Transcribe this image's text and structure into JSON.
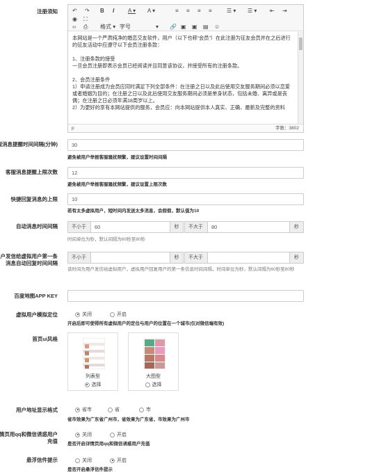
{
  "registration": {
    "label": "注册须知",
    "toolbar": {
      "format": "格式",
      "font": "字号"
    },
    "content": [
      "本网站是一个严肃纯净的婚恋交友软件，用户（以下也称“会员”）在此注册为征友会员并在之后进行的征友活动中应遵守以下会员注册条款：",
      "",
      "1、注册条款的接受",
      "一旦会员注册即表示会员已经阅读并且同意该协议，并接受所有的注册条款。",
      "",
      "2、会员注册条件",
      "1）申请注册成为会员应同时满足下列全部条件：在注册之日以及此后使用交友服务期间必须以恋爱或者婚姻为目的；在注册之日以及此后使用交友服务期间必须是单身状态，包括未婚、离异或是丧偶；在注册之日必须年满18周岁以上。",
      "2）为更好的享有本网站提供的服务，会员应：向本网站提供本人真实、正确、最新及完整的资料"
    ],
    "status_left": "p",
    "status_right": "字数：3802"
  },
  "reminder_interval": {
    "label": "客服消息提醒时间间隔(分钟)",
    "value": "30",
    "hint": "避免被用户举报客服骚扰频繁，建议设置时间间隔"
  },
  "reminder_limit": {
    "label": "客服消息提醒上限次数",
    "value": "12",
    "hint": "避免被用户举报客服骚扰频繁，建议设置上限次数"
  },
  "quick_reply_limit": {
    "label": "快捷回复消息的上限",
    "value": "10",
    "hint": "若有太多虚拟用户，短时间内发送太多消息，会假假，默认值为10"
  },
  "auto_msg_interval": {
    "label": "自动消息时间间隔",
    "min_label": "不小于",
    "min_value": "60",
    "unit": "秒",
    "max_label": "不大于",
    "max_value": "80",
    "hint": "时间单位为秒，默认间隔为60秒至80秒"
  },
  "first_msg_interval": {
    "label": "用户发信给虚拟用户第一条消息自动回复时间间隔",
    "min_label": "不小于",
    "min_value": "",
    "unit": "秒",
    "max_label": "不大于",
    "max_value": "",
    "hint": "该时间为用户发信给虚拟用户，虚拟用户回复用户的第一条信息时间间隔，时间单位为秒，默认间隔为60秒至80秒"
  },
  "baidu_key": {
    "label": "百度地图APP KEY",
    "value": ""
  },
  "virtual_location": {
    "label": "虚拟用户模拟定位",
    "options": [
      "关闭",
      "开启"
    ],
    "selected": 0,
    "hint": "开启后即可使得所有虚拟用户的定位与用户的位置在一个城市(仅对微信端有效)"
  },
  "home_style": {
    "label": "首页ui风格",
    "cards": [
      {
        "name": "列表型",
        "choose": "选择",
        "selected": true
      },
      {
        "name": "大图型",
        "choose": "选择",
        "selected": false
      }
    ]
  },
  "address_format": {
    "label": "用户地址显示格式",
    "options": [
      "省市",
      "省",
      "市"
    ],
    "selected": 0,
    "hint": "省市效果为广东省广州市，省效果为广东省，市效果为广州市"
  },
  "detail_qq": {
    "label": "详情页用qq和微信诱惑用户充值",
    "options": [
      "关闭",
      "开启"
    ],
    "selected": 0,
    "hint": "是否开启详情页用qq和微信诱惑用户充值"
  },
  "float_letter": {
    "label": "悬浮信件提示",
    "options": [
      "关闭",
      "开启"
    ],
    "selected": 1,
    "hint": "是否开启悬浮信件提示"
  },
  "colors": {
    "border": "#cccccc",
    "addon_bg": "#eeeeee",
    "toolbar_bg": "#f7f7f7"
  }
}
